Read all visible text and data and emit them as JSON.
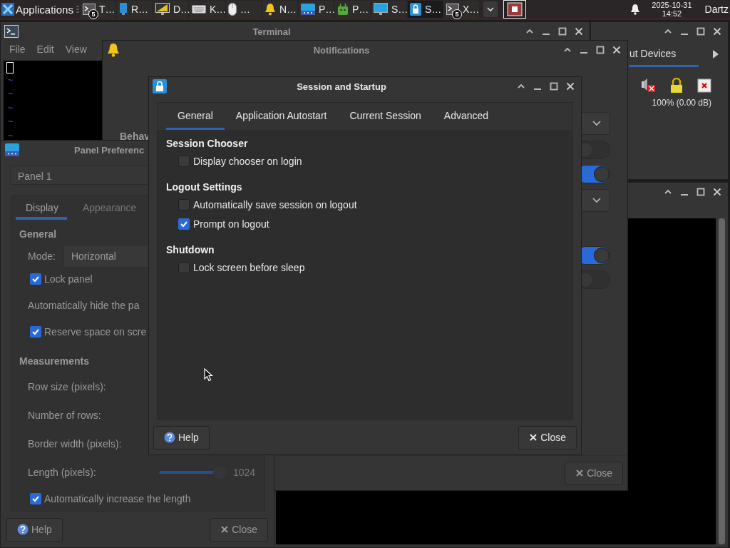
{
  "taskbar": {
    "menu": "Applications",
    "tasks": [
      {
        "kind": "terminal",
        "label": "T…",
        "badge": "5",
        "selected": false
      },
      {
        "kind": "device",
        "label": "R…",
        "selected": false
      },
      {
        "kind": "display",
        "label": "D…",
        "selected": false
      },
      {
        "kind": "keyboard",
        "label": "K…",
        "selected": false
      },
      {
        "kind": "mouse",
        "label": "…",
        "selected": false
      },
      {
        "kind": "bell",
        "label": "N…",
        "selected": false
      },
      {
        "kind": "panel",
        "label": "P…",
        "selected": false
      },
      {
        "kind": "package",
        "label": "P…",
        "selected": false
      },
      {
        "kind": "monitor",
        "label": "S…",
        "selected": false
      },
      {
        "kind": "session",
        "label": "S…",
        "selected": true
      },
      {
        "kind": "terminal",
        "label": "X…",
        "badge": "5",
        "selected": false
      }
    ],
    "date": "2025-10-31",
    "time": "14:52",
    "user": "Dartz"
  },
  "terminal": {
    "title": "Terminal",
    "menu": [
      "File",
      "Edit",
      "View"
    ],
    "lines": [
      "~",
      "~",
      "~",
      "~",
      "~"
    ]
  },
  "mixer": {
    "tabs": [
      {
        "label": "ut Devices",
        "selected": true
      }
    ],
    "volume": "100% (0.00 dB)"
  },
  "notifications": {
    "title": "Notifications",
    "heading": "Behav",
    "controls": [
      {
        "kind": "dropdown"
      },
      {
        "kind": "toggle",
        "on": false
      },
      {
        "kind": "toggle",
        "on": true
      },
      {
        "kind": "dropdown"
      },
      {
        "kind": "toggle",
        "on": true
      },
      {
        "kind": "toggle",
        "on": false
      }
    ],
    "close": "Close"
  },
  "panel_preferences": {
    "title": "Panel Preferenc",
    "panel": "Panel 1",
    "tabs": [
      {
        "label": "Display",
        "selected": true
      },
      {
        "label": "Appearance",
        "selected": false
      }
    ],
    "rows": [
      {
        "kind": "heading",
        "label": "General"
      },
      {
        "kind": "dropdown",
        "label": "Mode:",
        "value": "Horizontal"
      },
      {
        "kind": "check",
        "label": "Lock panel",
        "checked": true
      },
      {
        "kind": "label",
        "label": "Automatically hide the pa"
      },
      {
        "kind": "check",
        "label": "Reserve space on scre",
        "checked": true
      },
      {
        "kind": "heading",
        "label": "Measurements"
      },
      {
        "kind": "label",
        "label": "Row size (pixels):"
      },
      {
        "kind": "label",
        "label": "Number of rows:"
      },
      {
        "kind": "label",
        "label": "Border width (pixels):"
      },
      {
        "kind": "slider",
        "label": "Length (pixels):",
        "level": 0.82,
        "value": "1024"
      },
      {
        "kind": "check",
        "label": "Automatically increase the length",
        "checked": true
      }
    ],
    "help": "Help",
    "close": "Close"
  },
  "session": {
    "title": "Session and Startup",
    "tabs": [
      {
        "label": "General",
        "selected": true
      },
      {
        "label": "Application Autostart",
        "selected": false
      },
      {
        "label": "Current Session",
        "selected": false
      },
      {
        "label": "Advanced",
        "selected": false
      }
    ],
    "sections": [
      {
        "title": "Session Chooser",
        "options": [
          {
            "label": "Display chooser on login",
            "checked": false
          }
        ]
      },
      {
        "title": "Logout Settings",
        "options": [
          {
            "label": "Automatically save session on logout",
            "checked": false
          },
          {
            "label": "Prompt on logout",
            "checked": true
          }
        ]
      },
      {
        "title": "Shutdown",
        "options": [
          {
            "label": "Lock screen before sleep",
            "checked": false
          }
        ]
      }
    ],
    "help": "Help",
    "close": "Close"
  }
}
